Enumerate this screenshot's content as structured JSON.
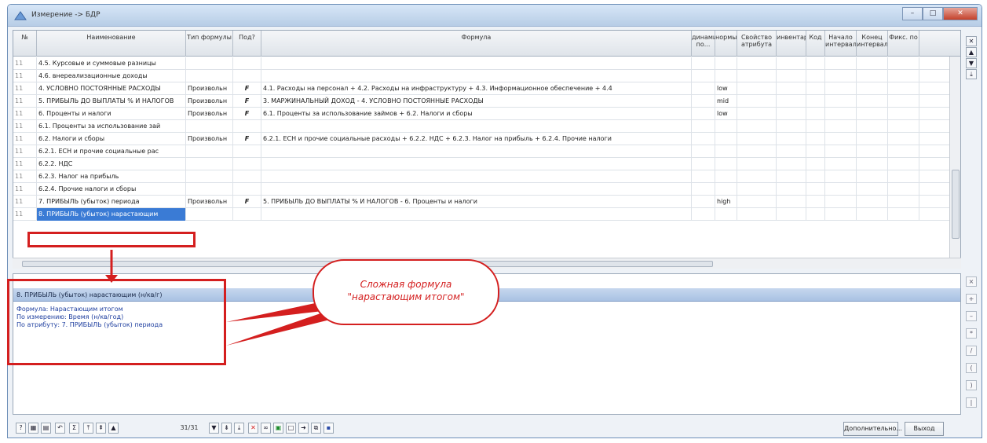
{
  "window": {
    "title": "Измерение -> БДР",
    "buttons": {
      "minimize": "–",
      "maximize": "□",
      "close": "✕"
    }
  },
  "grid": {
    "columns": [
      {
        "label": "№"
      },
      {
        "label": "Наименование"
      },
      {
        "label": "Тип формулы"
      },
      {
        "label": "Под?"
      },
      {
        "label": "Формула"
      },
      {
        "label": "динамики по..."
      },
      {
        "label": "нормы"
      },
      {
        "label": "Свойство атрибута"
      },
      {
        "label": "инвентар"
      },
      {
        "label": "Код"
      },
      {
        "label": "Начало интервала"
      },
      {
        "label": "Конец интервала"
      },
      {
        "label": "Фикс. по"
      }
    ],
    "rows": [
      {
        "num": "11",
        "name": "4.5. Курсовые и суммовые разницы",
        "type": "",
        "f": "",
        "formula": "",
        "norm": ""
      },
      {
        "num": "11",
        "name": "4.6. внереализационные доходы",
        "type": "",
        "f": "",
        "formula": "",
        "norm": ""
      },
      {
        "num": "11",
        "name": "4. УСЛОВНО ПОСТОЯННЫЕ РАСХОДЫ",
        "type": "Произвольн",
        "f": "F",
        "formula": "4.1. Расходы на персонал + 4.2. Расходы на инфраструктуру + 4.3. Информационное обеспечение + 4.4",
        "norm": "low"
      },
      {
        "num": "11",
        "name": "5. ПРИБЫЛЬ ДО ВЫПЛАТЫ % И НАЛОГОВ",
        "type": "Произвольн",
        "f": "F",
        "formula": "3. МАРЖИНАЛЬНЫЙ ДОХОД - 4. УСЛОВНО ПОСТОЯННЫЕ РАСХОДЫ",
        "norm": "mid"
      },
      {
        "num": "11",
        "name": "6. Проценты и налоги",
        "type": "Произвольн",
        "f": "F",
        "formula": "6.1. Проценты за использование займов + 6.2. Налоги и сборы",
        "norm": "low"
      },
      {
        "num": "11",
        "name": "6.1. Проценты за использование зай",
        "type": "",
        "f": "",
        "formula": "",
        "norm": ""
      },
      {
        "num": "11",
        "name": "6.2. Налоги и сборы",
        "type": "Произвольн",
        "f": "F",
        "formula": "6.2.1. ЕСН и прочие социальные расходы + 6.2.2. НДС + 6.2.3. Налог на прибыль + 6.2.4. Прочие налоги",
        "norm": ""
      },
      {
        "num": "11",
        "name": "6.2.1. ЕСН и прочие социальные рас",
        "type": "",
        "f": "",
        "formula": "",
        "norm": ""
      },
      {
        "num": "11",
        "name": "6.2.2. НДС",
        "type": "",
        "f": "",
        "formula": "",
        "norm": ""
      },
      {
        "num": "11",
        "name": "6.2.3. Налог на прибыль",
        "type": "",
        "f": "",
        "formula": "",
        "norm": ""
      },
      {
        "num": "11",
        "name": "6.2.4. Прочие налоги и сборы",
        "type": "",
        "f": "",
        "formula": "",
        "norm": ""
      },
      {
        "num": "11",
        "name": "7. ПРИБЫЛЬ (убыток) периода",
        "type": "Произвольн",
        "f": "F",
        "formula": "5. ПРИБЫЛЬ ДО ВЫПЛАТЫ % И НАЛОГОВ - 6. Проценты и налоги",
        "norm": "high"
      },
      {
        "num": "11",
        "name": "8. ПРИБЫЛЬ (убыток) нарастающим",
        "type": "",
        "f": "",
        "formula": "",
        "norm": "",
        "selected": true
      }
    ]
  },
  "detail": {
    "header": "8. ПРИБЫЛЬ (убыток) нарастающим (н/кв/г)",
    "lines": [
      "Формула: Нарастающим итогом",
      "По измерению: Время (н/кв/год)",
      "По атрибуту: 7. ПРИБЫЛЬ (убыток) периода"
    ]
  },
  "callout": {
    "line1": "Сложная формула",
    "line2": "\"нарастающим итогом\""
  },
  "toolbar": {
    "counter": "31/31",
    "more_label": "Дополнительно...",
    "exit_label": "Выход"
  },
  "colors": {
    "accent": "#3a7bd5",
    "annotation": "#d41f1f"
  }
}
